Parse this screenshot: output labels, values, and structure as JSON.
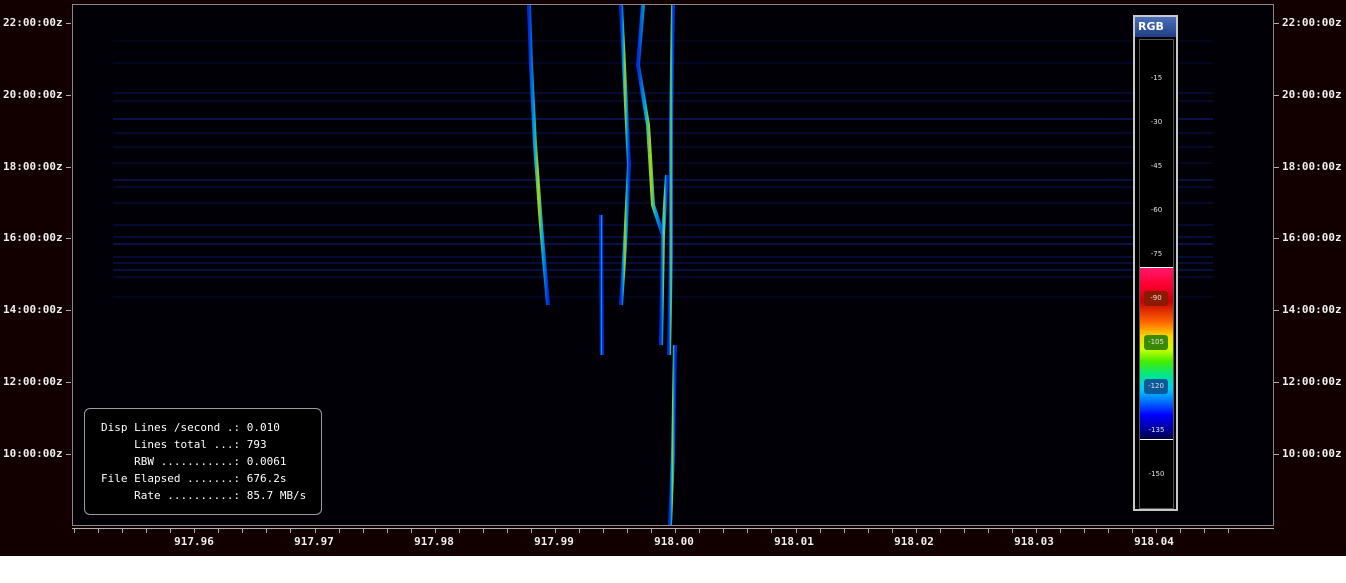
{
  "time_axis": {
    "labels": [
      "22:00:00z",
      "20:00:00z",
      "18:00:00z",
      "16:00:00z",
      "14:00:00z",
      "12:00:00z",
      "10:00:00z"
    ]
  },
  "freq_axis": {
    "labels": [
      "917.96",
      "917.97",
      "917.98",
      "917.99",
      "918.00",
      "918.01",
      "918.02",
      "918.03",
      "918.04"
    ]
  },
  "info": {
    "rows": [
      {
        "label": "Disp Lines /second .:",
        "value": "0.010"
      },
      {
        "label": "     Lines total ...:",
        "value": "793"
      },
      {
        "label": "     RBW ...........:",
        "value": "0.0061"
      },
      {
        "label": "File Elapsed .......:",
        "value": "676.2s"
      },
      {
        "label": "     Rate ..........:",
        "value": "85.7 MB/s"
      }
    ]
  },
  "legend": {
    "title": "RGB",
    "levels": [
      "-15",
      "-30",
      "-45",
      "-60",
      "-75",
      "-90",
      "-105",
      "-120",
      "-135",
      "-150"
    ],
    "level_colors": [
      "",
      "",
      "",
      "",
      "",
      "#8a1b00",
      "#3a8a00",
      "#0a5a9a",
      "",
      ""
    ]
  }
}
